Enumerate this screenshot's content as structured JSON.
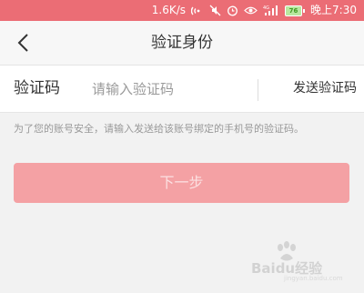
{
  "status_bar": {
    "network_speed": "1.6K/s",
    "battery_level": "76",
    "time": "晚上7:30",
    "background_color": "#eb6d75",
    "icons": [
      "nfc-icon",
      "mute-icon",
      "alarm-icon",
      "eye-icon",
      "signal-4g-icon",
      "battery-icon"
    ]
  },
  "nav": {
    "title": "验证身份",
    "back_icon": "chevron-left-icon"
  },
  "form": {
    "code_label": "验证码",
    "code_placeholder": "请输入验证码",
    "code_value": "",
    "send_code_label": "发送验证码"
  },
  "hint": "为了您的账号安全，请输入发送给该账号绑定的手机号的验证码。",
  "next_button": {
    "label": "下一步",
    "color": "#f4a1a4"
  },
  "watermark": {
    "brand": "Baidu经验",
    "sub": "jingyan.baidu.com"
  }
}
